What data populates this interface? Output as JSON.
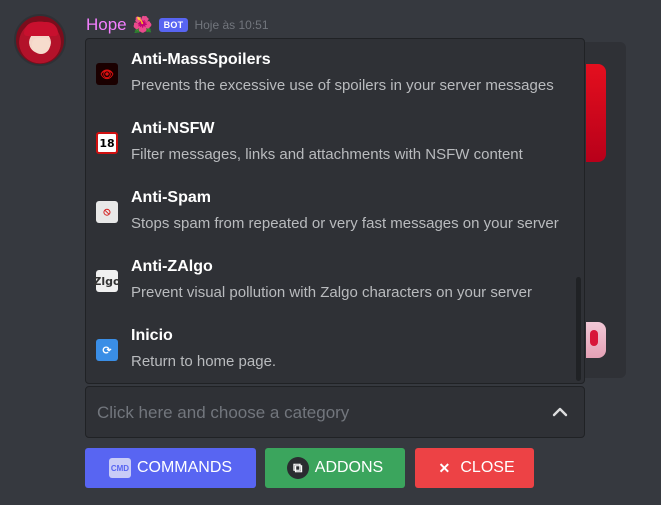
{
  "message": {
    "author": "Hope",
    "author_flower": "🌺",
    "badge": "BOT",
    "timestamp": "Hoje às 10:51"
  },
  "menu": {
    "options": [
      {
        "label": "Anti-MassSpoilers",
        "description": "Prevents the excessive use of spoilers in your server messages",
        "icon": "eye-spoiler-icon",
        "icon_glyph": "👁"
      },
      {
        "label": "Anti-NSFW",
        "description": "Filter messages, links and attachments with NSFW content",
        "icon": "no-18-icon",
        "icon_glyph": "18"
      },
      {
        "label": "Anti-Spam",
        "description": "Stops spam from repeated or very fast messages on your server",
        "icon": "no-spam-icon",
        "icon_glyph": "⦸"
      },
      {
        "label": "Anti-ZAlgo",
        "description": "Prevent visual pollution with Zalgo characters on your server",
        "icon": "zalgo-icon",
        "icon_glyph": "Zlgo"
      },
      {
        "label": "Inicio",
        "description": "Return to home page.",
        "icon": "refresh-icon",
        "icon_glyph": "⟳"
      }
    ]
  },
  "select": {
    "placeholder": "Click here and choose a category"
  },
  "buttons": {
    "commands": {
      "label": "COMMANDS",
      "icon_text": "CMD"
    },
    "addons": {
      "label": "ADDONS",
      "icon_text": "⧉"
    },
    "close": {
      "label": "CLOSE",
      "icon_text": "✕"
    }
  },
  "colors": {
    "background": "#36393f",
    "username": "#f47fff",
    "bot_badge": "#5865f2",
    "commands_button": "#5865f2",
    "addons_button": "#3ba55d",
    "close_button": "#ed4245"
  }
}
